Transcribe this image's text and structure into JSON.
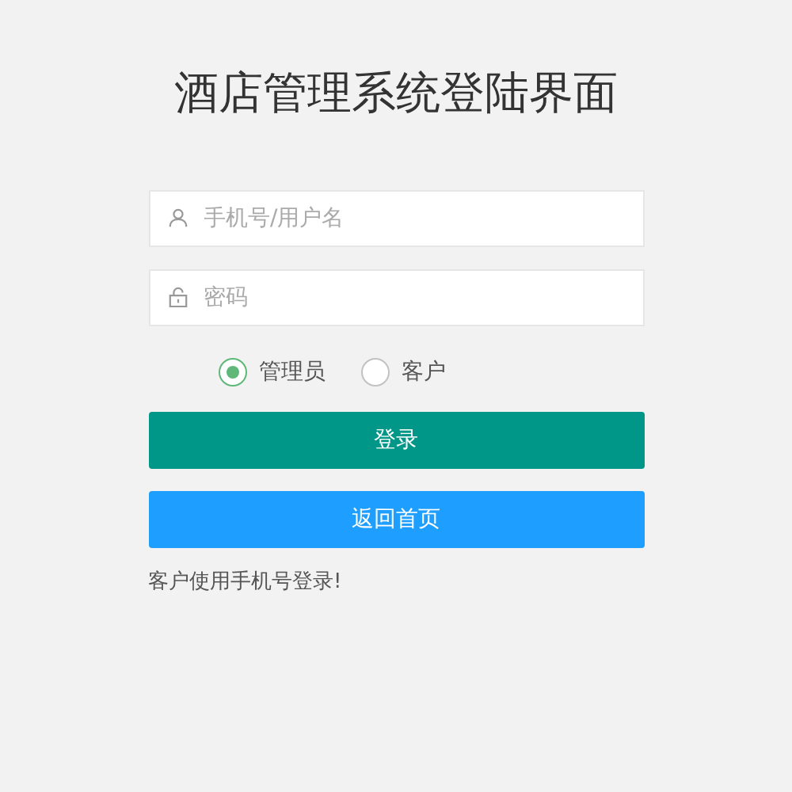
{
  "title": "酒店管理系统登陆界面",
  "fields": [
    {
      "kind": "user",
      "placeholder": "手机号/用户名"
    },
    {
      "kind": "lock",
      "placeholder": "密码"
    }
  ],
  "roles": [
    {
      "label": "管理员",
      "selected": true
    },
    {
      "label": "客户",
      "selected": false
    }
  ],
  "buttons": [
    {
      "kind": "primary",
      "label": "登录"
    },
    {
      "kind": "secondary",
      "label": "返回首页"
    }
  ],
  "note": "客户使用手机号登录!"
}
